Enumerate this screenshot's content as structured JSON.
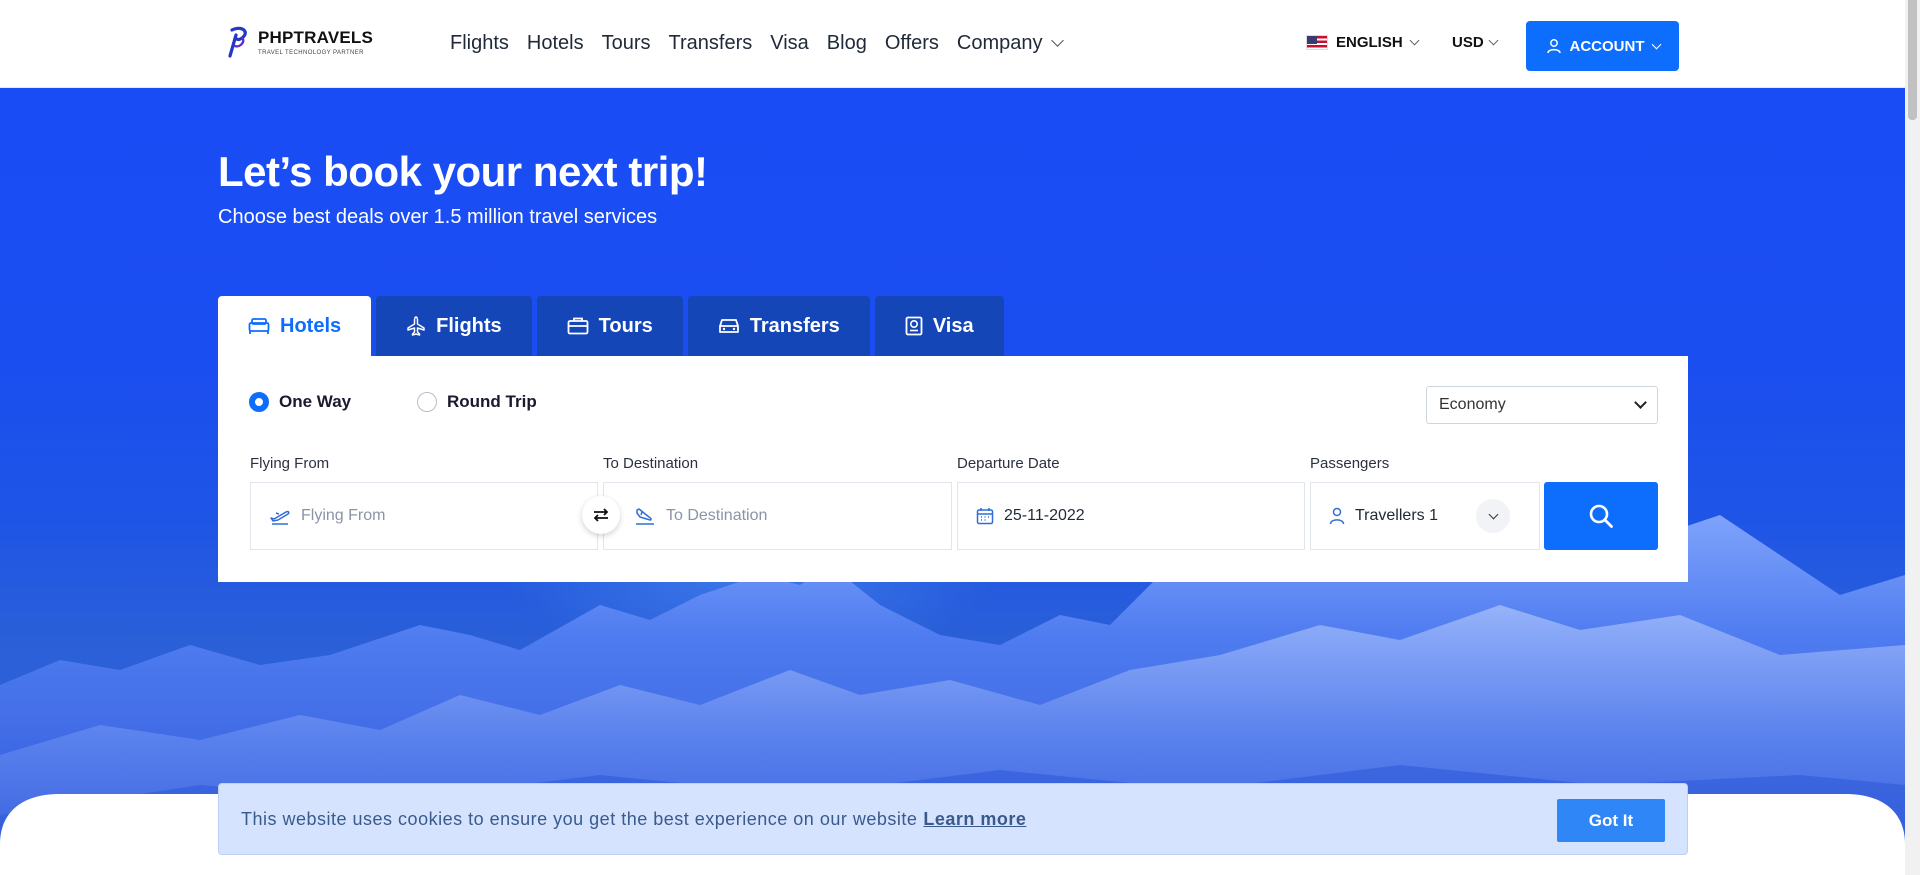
{
  "brand": {
    "name": "PHPTRAVELS",
    "tagline": "TRAVEL TECHNOLOGY PARTNER"
  },
  "nav": {
    "items": [
      {
        "label": "Flights"
      },
      {
        "label": "Hotels"
      },
      {
        "label": "Tours"
      },
      {
        "label": "Transfers"
      },
      {
        "label": "Visa"
      },
      {
        "label": "Blog"
      },
      {
        "label": "Offers"
      },
      {
        "label": "Company"
      }
    ]
  },
  "header": {
    "language": "ENGLISH",
    "currency": "USD",
    "account_label": "ACCOUNT"
  },
  "hero": {
    "title": "Let’s book your next trip!",
    "subtitle": "Choose best deals over 1.5 million travel services"
  },
  "tabs": [
    {
      "label": "Hotels",
      "icon": "bed-icon",
      "active": true
    },
    {
      "label": "Flights",
      "icon": "plane-icon",
      "active": false
    },
    {
      "label": "Tours",
      "icon": "suitcase-icon",
      "active": false
    },
    {
      "label": "Transfers",
      "icon": "car-icon",
      "active": false
    },
    {
      "label": "Visa",
      "icon": "passport-icon",
      "active": false
    }
  ],
  "search": {
    "trip_types": [
      {
        "label": "One Way",
        "selected": true
      },
      {
        "label": "Round Trip",
        "selected": false
      }
    ],
    "cabin_class": "Economy",
    "from_label": "Flying From",
    "from_placeholder": "Flying From",
    "to_label": "To Destination",
    "to_placeholder": "To Destination",
    "date_label": "Departure Date",
    "date_value": "25-11-2022",
    "passengers_label": "Passengers",
    "passengers_value": "Travellers 1"
  },
  "cookie": {
    "message": "This website uses cookies to ensure you get the best experience on our website",
    "learn_more": "Learn more",
    "button": "Got It"
  },
  "colors": {
    "primary": "#0d6efd",
    "hero_blue": "#1a4cf6",
    "tab_inactive": "#1446b8",
    "cookie_bg": "#d6e3ff"
  }
}
